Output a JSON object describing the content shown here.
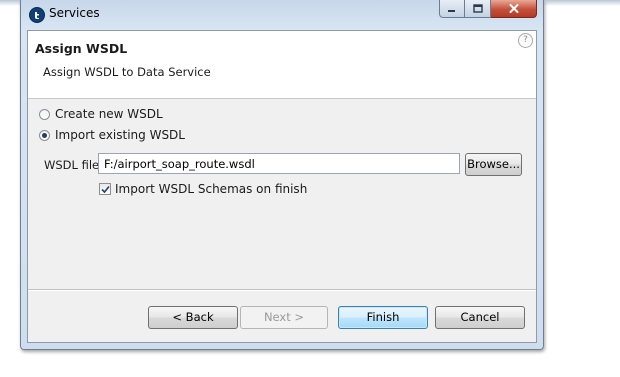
{
  "window": {
    "title": "Services",
    "controls": {
      "minimize": "minimize-icon",
      "maximize": "maximize-icon",
      "close": "close-icon"
    }
  },
  "banner": {
    "title": "Assign WSDL",
    "subtitle": "Assign WSDL to Data Service",
    "help": "?"
  },
  "options": {
    "create_new": {
      "label": "Create new WSDL",
      "selected": false
    },
    "import_existing": {
      "label": "Import existing WSDL",
      "selected": true
    }
  },
  "wsdl_file": {
    "label": "WSDL file",
    "value": "F:/airport_soap_route.wsdl",
    "browse_label": "Browse..."
  },
  "import_schemas": {
    "label": "Import WSDL Schemas on finish",
    "checked": true
  },
  "footer": {
    "back_label": "< Back",
    "next_label": "Next >",
    "finish_label": "Finish",
    "cancel_label": "Cancel"
  },
  "colors": {
    "title_bar": "#cfdeef",
    "close_button": "#c5503a",
    "default_button_border": "#3c7fb1",
    "app_icon": "#0f3f74"
  }
}
